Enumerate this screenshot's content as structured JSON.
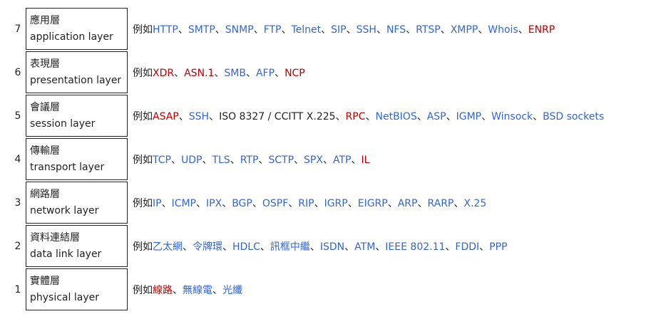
{
  "prefix": "例如",
  "separator": "、",
  "colors": {
    "link": "#3366cc",
    "redlink": "#ba0000",
    "text": "#202122"
  },
  "layers": [
    {
      "number": "7",
      "zh": "應用層",
      "en": "application layer",
      "examples": [
        [
          "HTTP",
          "link"
        ],
        [
          "SMTP",
          "link"
        ],
        [
          "SNMP",
          "link"
        ],
        [
          "FTP",
          "link"
        ],
        [
          "Telnet",
          "link"
        ],
        [
          "SIP",
          "link"
        ],
        [
          "SSH",
          "link"
        ],
        [
          "NFS",
          "link"
        ],
        [
          "RTSP",
          "link"
        ],
        [
          "XMPP",
          "link"
        ],
        [
          "Whois",
          "link"
        ],
        [
          "ENRP",
          "new"
        ]
      ]
    },
    {
      "number": "6",
      "zh": "表現層",
      "en": "presentation layer",
      "examples": [
        [
          "XDR",
          "new"
        ],
        [
          "ASN.1",
          "new"
        ],
        [
          "SMB",
          "link"
        ],
        [
          "AFP",
          "link"
        ],
        [
          "NCP",
          "new"
        ]
      ]
    },
    {
      "number": "5",
      "zh": "會議層",
      "en": "session layer",
      "examples": [
        [
          "ASAP",
          "new"
        ],
        [
          "SSH",
          "link"
        ],
        [
          "ISO 8327 / CCITT X.225",
          "plain"
        ],
        [
          "RPC",
          "new"
        ],
        [
          "NetBIOS",
          "link"
        ],
        [
          "ASP",
          "link"
        ],
        [
          "IGMP",
          "link"
        ],
        [
          "Winsock",
          "link"
        ],
        [
          "BSD sockets",
          "link"
        ]
      ]
    },
    {
      "number": "4",
      "zh": "傳輸層",
      "en": "transport layer",
      "examples": [
        [
          "TCP",
          "link"
        ],
        [
          "UDP",
          "link"
        ],
        [
          "TLS",
          "link"
        ],
        [
          "RTP",
          "link"
        ],
        [
          "SCTP",
          "link"
        ],
        [
          "SPX",
          "link"
        ],
        [
          "ATP",
          "link"
        ],
        [
          "IL",
          "new"
        ]
      ]
    },
    {
      "number": "3",
      "zh": "網路層",
      "en": "network layer",
      "examples": [
        [
          "IP",
          "link"
        ],
        [
          "ICMP",
          "link"
        ],
        [
          "IPX",
          "link"
        ],
        [
          "BGP",
          "link"
        ],
        [
          "OSPF",
          "link"
        ],
        [
          "RIP",
          "link"
        ],
        [
          "IGRP",
          "link"
        ],
        [
          "EIGRP",
          "link"
        ],
        [
          "ARP",
          "link"
        ],
        [
          "RARP",
          "link"
        ],
        [
          "X.25",
          "link"
        ]
      ]
    },
    {
      "number": "2",
      "zh": "資料連結層",
      "en": "data link layer",
      "examples": [
        [
          "乙太網",
          "link"
        ],
        [
          "令牌環",
          "link"
        ],
        [
          "HDLC",
          "link"
        ],
        [
          "訊框中繼",
          "link"
        ],
        [
          "ISDN",
          "link"
        ],
        [
          "ATM",
          "link"
        ],
        [
          "IEEE 802.11",
          "link"
        ],
        [
          "FDDI",
          "link"
        ],
        [
          "PPP",
          "link"
        ]
      ]
    },
    {
      "number": "1",
      "zh": "實體層",
      "en": "physical layer",
      "examples": [
        [
          "線路",
          "new"
        ],
        [
          "無線電",
          "link"
        ],
        [
          "光纖",
          "link"
        ]
      ]
    }
  ]
}
